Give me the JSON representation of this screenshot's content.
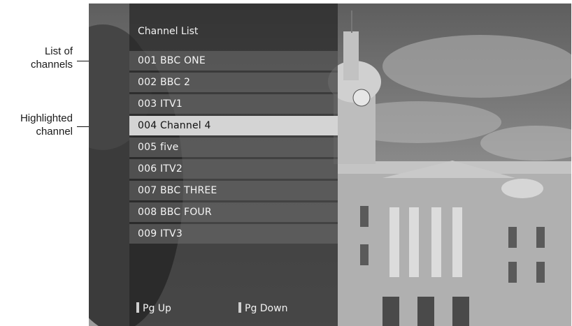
{
  "callouts": {
    "list_of_channels": [
      "List of",
      "channels"
    ],
    "highlighted_channel": [
      "Highlighted",
      "channel"
    ]
  },
  "channel_list": {
    "title": "Channel List",
    "highlighted_index": 3,
    "channels": [
      {
        "label": "001 BBC ONE"
      },
      {
        "label": "002 BBC 2"
      },
      {
        "label": "003 ITV1"
      },
      {
        "label": "004 Channel 4"
      },
      {
        "label": "005 five"
      },
      {
        "label": "006 ITV2"
      },
      {
        "label": "007 BBC THREE"
      },
      {
        "label": "008 BBC FOUR"
      },
      {
        "label": "009 ITV3"
      }
    ]
  },
  "footer": {
    "page_up": "Pg Up",
    "page_down": "Pg Down"
  },
  "colors": {
    "panel_background": "#262626",
    "row_background": "#707070",
    "highlight_background": "#d4d4d4"
  }
}
